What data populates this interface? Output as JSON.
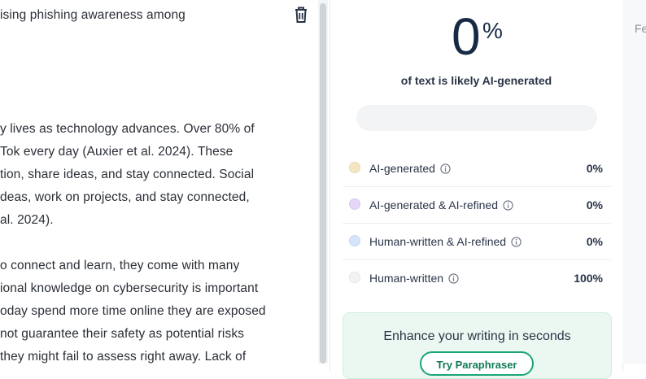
{
  "editor": {
    "lines": [
      "ising phishing awareness among",
      "y lives as technology advances. Over 80% of",
      "Tok every day (Auxier et al. 2024).  These",
      "tion, share ideas, and stay connected. Social",
      "deas, work on projects, and stay connected,",
      "al. 2024).",
      "o connect and learn, they come with many",
      "ional knowledge on cybersecurity is important",
      "oday spend more time online they are exposed",
      "not guarantee their safety as potential risks",
      "they might fail to assess right away. Lack of"
    ]
  },
  "detector": {
    "score": "0",
    "score_unit": "%",
    "subtitle": "of text is likely AI-generated",
    "bar_fraction": 0,
    "rows": [
      {
        "label": "AI-generated",
        "value": "0%",
        "color": "#f5e6c2"
      },
      {
        "label": "AI-generated & AI-refined",
        "value": "0%",
        "color": "#e6d6f7"
      },
      {
        "label": "Human-written & AI-refined",
        "value": "0%",
        "color": "#d4e4fb"
      },
      {
        "label": "Human-written",
        "value": "100%",
        "color": "#f2f3f5"
      }
    ],
    "cta_text": "Enhance your writing in seconds",
    "cta_button": "Try Paraphraser"
  },
  "far_right": {
    "text": "Fe"
  }
}
